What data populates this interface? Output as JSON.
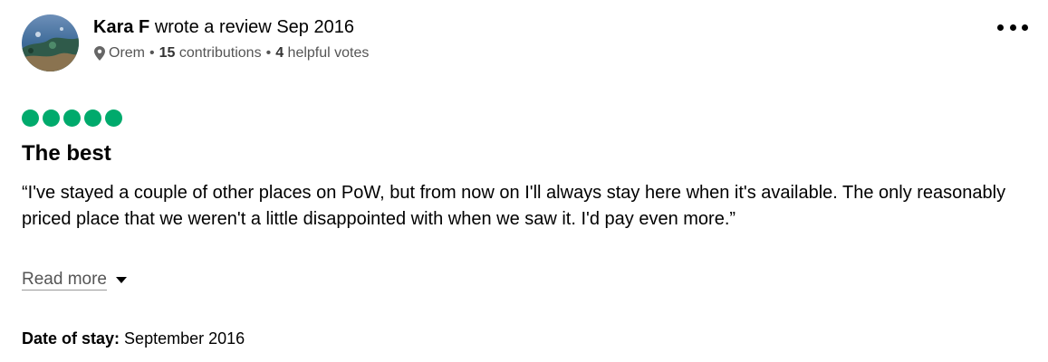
{
  "review": {
    "author": "Kara F",
    "action_text": "wrote a review",
    "review_date": "Sep 2016",
    "location": "Orem",
    "contributions_count": "15",
    "contributions_label": "contributions",
    "helpful_votes_count": "4",
    "helpful_votes_label": "helpful votes",
    "meta_separator": "•",
    "rating": 5,
    "rating_max": 5,
    "title": "The best",
    "text": "“I've stayed a couple of other places on PoW, but from now on I'll always stay here when it's available. The only reasonably priced place that we weren't a little disappointed with when we saw it. I'd pay even more.”",
    "read_more_label": "Read more",
    "date_of_stay_label": "Date of stay:",
    "date_of_stay_value": "September 2016"
  },
  "icons": {
    "location": "map-pin-icon",
    "more": "more-options-icon",
    "read_more": "caret-down-icon"
  },
  "colors": {
    "bubble_fill": "#00aa6c",
    "meta_text": "#555555"
  }
}
